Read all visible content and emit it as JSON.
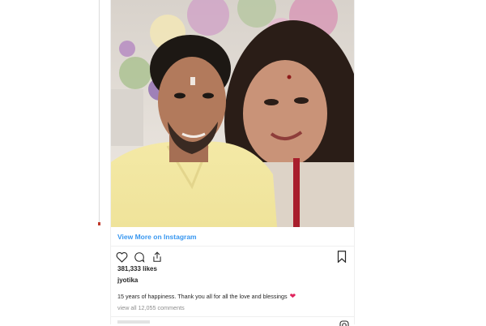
{
  "post": {
    "view_more_label": "View More on Instagram",
    "likes_text": "381,333 likes",
    "username": "jyotika",
    "caption": "15 years of happiness. Thank you all for all the love and blessings",
    "caption_emoji": "❤",
    "comments_link": "view all 12,055 comments"
  },
  "icons": {
    "like": "heart-outline-icon",
    "comment": "comment-bubble-icon",
    "share": "share-icon",
    "save": "bookmark-icon",
    "instagram": "instagram-icon"
  },
  "colors": {
    "link": "#3897f0",
    "heart": "#e0245e",
    "muted": "#8e8e8e"
  }
}
